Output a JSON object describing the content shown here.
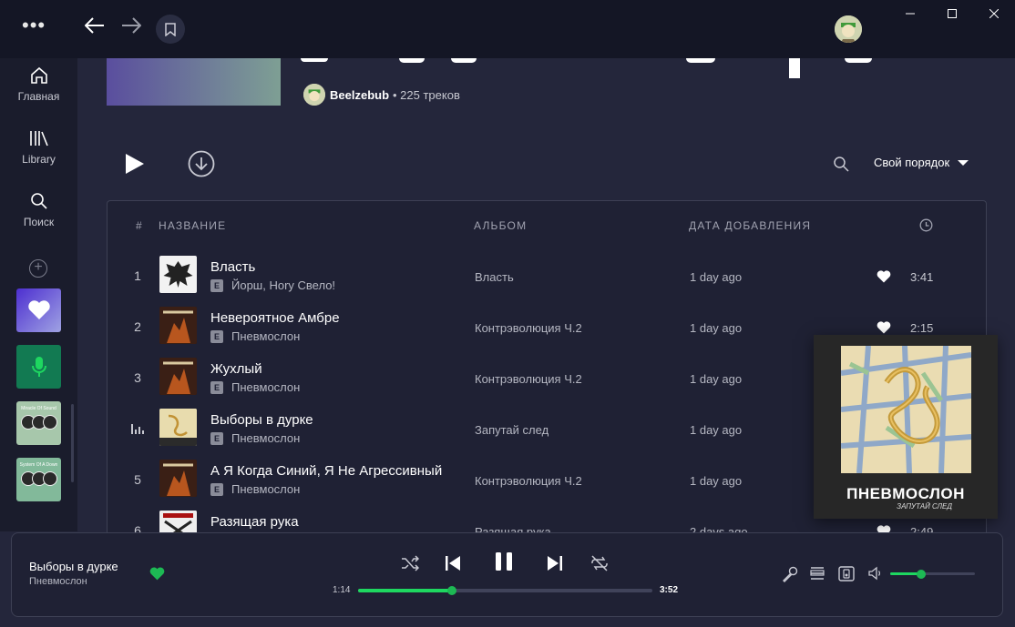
{
  "colors": {
    "accent": "#1db954",
    "bg": "#24263b",
    "panel": "#1f2134"
  },
  "window": {
    "menu": "•••"
  },
  "sidebar": {
    "items": [
      {
        "label": "Главная",
        "icon": "home-icon"
      },
      {
        "label": "Library",
        "icon": "library-icon"
      },
      {
        "label": "Поиск",
        "icon": "search-icon"
      }
    ],
    "tiles": [
      {
        "name": "Liked Songs",
        "icon": "heart-icon"
      },
      {
        "name": "Podcast",
        "icon": "microphone-icon"
      },
      {
        "title": "Miracle Of Sound"
      },
      {
        "title": "System Of A Down"
      }
    ]
  },
  "playlist": {
    "owner": "Beelzebub",
    "track_count": "• 225 треков",
    "sort_label": "Свой порядок"
  },
  "table": {
    "headers": {
      "num": "#",
      "title": "НАЗВАНИЕ",
      "album": "АЛЬБОМ",
      "added": "ДАТА ДОБАВЛЕНИЯ"
    },
    "rows": [
      {
        "num": "1",
        "title": "Власть",
        "artist": "Йорш, Hory Свело!",
        "album": "Власть",
        "added": "1 day ago",
        "duration": "3:41",
        "liked": true
      },
      {
        "num": "2",
        "title": "Невероятное Амбре",
        "artist": "Пневмослон",
        "album": "Контрэволюция Ч.2",
        "added": "1 day ago",
        "duration": "2:15",
        "liked": true
      },
      {
        "num": "3",
        "title": "Жухлый",
        "artist": "Пневмослон",
        "album": "Контрэволюция Ч.2",
        "added": "1 day ago",
        "duration": "",
        "liked": false
      },
      {
        "num": "",
        "title": "Выборы в дурке",
        "artist": "Пневмослон",
        "album": "Запутай след",
        "added": "1 day ago",
        "duration": "",
        "liked": false,
        "playing": true
      },
      {
        "num": "5",
        "title": "А Я Когда Синий, Я Не Агрессивный",
        "artist": "Пневмослон",
        "album": "Контрэволюция Ч.2",
        "added": "1 day ago",
        "duration": "",
        "liked": false
      },
      {
        "num": "6",
        "title": "Разящая рука",
        "artist": "",
        "album": "Разящая рука",
        "added": "2 days ago",
        "duration": "2:49",
        "liked": true
      }
    ],
    "explicit": "E"
  },
  "cover": {
    "brand": "ПНЕВМОСЛОН",
    "subtitle": "ЗАПУТАЙ СЛЕД"
  },
  "player": {
    "title": "Выборы в дурке",
    "artist": "Пневмослон",
    "current": "1:14",
    "total": "3:52",
    "progress": 0.32,
    "volume": 0.37
  }
}
